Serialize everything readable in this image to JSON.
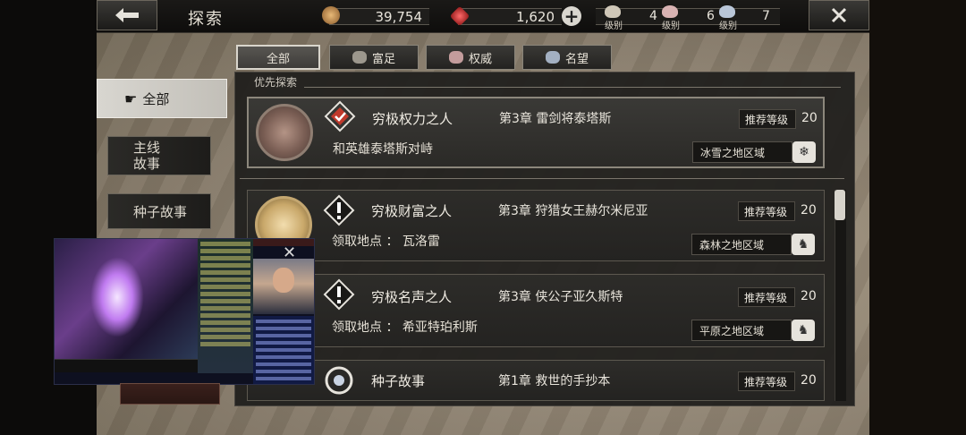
{
  "header": {
    "title": "探索",
    "back_icon": "left-arrow-icon",
    "close_icon": "close-icon"
  },
  "resources": {
    "gold": "39,754",
    "gems": "1,620",
    "add_symbol": "+",
    "rank_label": "级别",
    "ranks": [
      "4",
      "6",
      "7"
    ]
  },
  "tabs": [
    {
      "label": "全部",
      "icon": ""
    },
    {
      "label": "富足",
      "icon": "wealth-icon"
    },
    {
      "label": "权威",
      "icon": "authority-icon"
    },
    {
      "label": "名望",
      "icon": "fame-icon"
    }
  ],
  "sidebar": {
    "items": [
      {
        "label": "全部",
        "icon": "pointing-hand-icon"
      },
      {
        "label": "主线\n故事"
      },
      {
        "label": "种子故事"
      }
    ]
  },
  "section": {
    "label": "优先探索"
  },
  "quests": [
    {
      "title": "穷极权力之人",
      "chapter": "第3章  雷剑将泰塔斯",
      "rec": "推荐等级",
      "level": "20",
      "sub": "和英雄泰塔斯对峙",
      "region": "冰雪之地区域"
    },
    {
      "title": "穷极财富之人",
      "chapter": "第3章  狩猎女王赫尔米尼亚",
      "rec": "推荐等级",
      "level": "20",
      "sub": "领取地点 ： 瓦洛雷",
      "region": "森林之地区域"
    },
    {
      "title": "穷极名声之人",
      "chapter": "第3章  侠公子亚久斯特",
      "rec": "推荐等级",
      "level": "20",
      "sub": "领取地点 ： 希亚特珀利斯",
      "region": "平原之地区域"
    },
    {
      "title": "种子故事",
      "chapter": "第1章  救世的手抄本",
      "rec": "推荐等级",
      "level": "20"
    }
  ],
  "colors": {
    "parchment": "#8d8170",
    "panel": "#201f1d",
    "accent_red": "#c0392b"
  }
}
